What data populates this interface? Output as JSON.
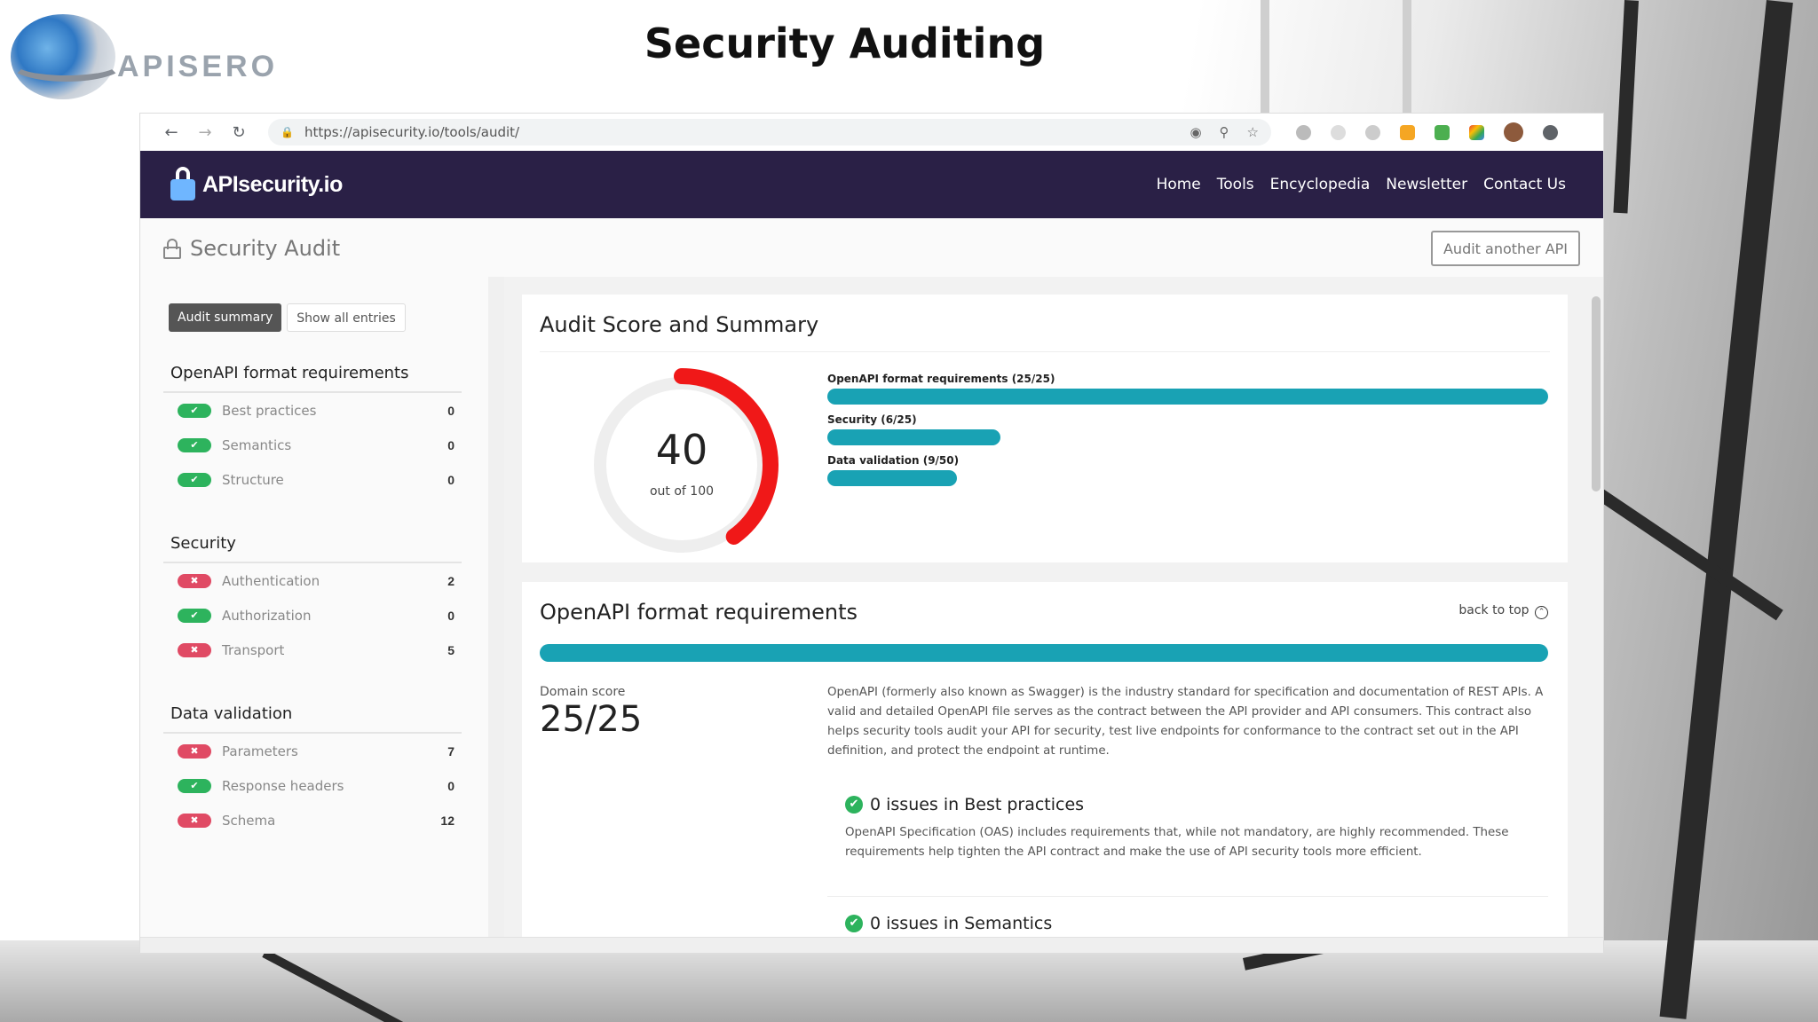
{
  "slide": {
    "title": "Security Auditing",
    "logo_text": "APISERO"
  },
  "browser": {
    "url": "https://apisecurity.io/tools/audit/"
  },
  "navbar": {
    "brand": "APIsecurity.io",
    "links": [
      "Home",
      "Tools",
      "Encyclopedia",
      "Newsletter",
      "Contact Us"
    ]
  },
  "page": {
    "title": "Security Audit",
    "audit_another_label": "Audit another API"
  },
  "sidebar": {
    "tabs": [
      "Audit summary",
      "Show all entries"
    ],
    "sections": [
      {
        "title": "OpenAPI format requirements",
        "items": [
          {
            "label": "Best practices",
            "status": "pass",
            "count": "0"
          },
          {
            "label": "Semantics",
            "status": "pass",
            "count": "0"
          },
          {
            "label": "Structure",
            "status": "pass",
            "count": "0"
          }
        ]
      },
      {
        "title": "Security",
        "items": [
          {
            "label": "Authentication",
            "status": "fail",
            "count": "2"
          },
          {
            "label": "Authorization",
            "status": "pass",
            "count": "0"
          },
          {
            "label": "Transport",
            "status": "fail",
            "count": "5"
          }
        ]
      },
      {
        "title": "Data validation",
        "items": [
          {
            "label": "Parameters",
            "status": "fail",
            "count": "7"
          },
          {
            "label": "Response headers",
            "status": "pass",
            "count": "0"
          },
          {
            "label": "Schema",
            "status": "fail",
            "count": "12"
          }
        ]
      }
    ]
  },
  "summary": {
    "title": "Audit Score and Summary",
    "score": "40",
    "score_sub": "out of 100",
    "score_fraction": 0.4,
    "bars": [
      {
        "label": "OpenAPI format requirements (25/25)",
        "fraction": 1.0
      },
      {
        "label": "Security (6/25)",
        "fraction": 0.24
      },
      {
        "label": "Data validation (9/50)",
        "fraction": 0.18
      }
    ]
  },
  "format_section": {
    "title": "OpenAPI format requirements",
    "back_to_top": "back to top",
    "domain_label": "Domain score",
    "domain_score": "25/25",
    "description": "OpenAPI (formerly also known as Swagger) is the industry standard for specification and documentation of REST APIs. A valid and detailed OpenAPI file serves as the contract between the API provider and API consumers. This contract also helps security tools audit your API for security, test live endpoints for conformance to the contract set out in the API definition, and protect the endpoint at runtime.",
    "issues": [
      {
        "title": "0 issues in Best practices",
        "description": "OpenAPI Specification (OAS) includes requirements that, while not mandatory, are highly recommended. These requirements help tighten the API contract and make the use of API security tools more efficient."
      },
      {
        "title": "0 issues in Semantics"
      }
    ]
  },
  "colors": {
    "navbar": "#2a2046",
    "accent_bar": "#19a2b4",
    "pass": "#2db35d",
    "fail": "#e04a64",
    "score_arc": "#f01818"
  }
}
